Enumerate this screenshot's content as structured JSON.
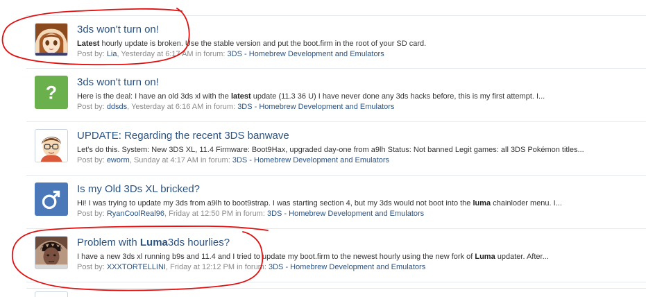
{
  "results": [
    {
      "title": "3ds won't turn on!",
      "snippet_bold": "Latest",
      "snippet_rest": " hourly update is broken. Use the stable version and put the boot.firm in the root of your SD card.",
      "post_by_label": "Post by:",
      "author": "Lia",
      "time": "Yesterday at 6:17 AM",
      "in_forum_label": "in forum:",
      "forum": "3DS - Homebrew Development and Emulators",
      "avatar": "anime-avatar"
    },
    {
      "title": "3ds won't turn on!",
      "snippet_pre": "Here is the deal: I have an old 3ds xl with the ",
      "snippet_bold": "latest",
      "snippet_post": " update (11.3 36 U) I have never done any 3ds hacks before, this is my first attempt. I...",
      "post_by_label": "Post by:",
      "author": "ddsds",
      "time": "Yesterday at 6:16 AM",
      "in_forum_label": "in forum:",
      "forum": "3DS - Homebrew Development and Emulators",
      "avatar": "question-mark-avatar"
    },
    {
      "title": "UPDATE: Regarding the recent 3DS banwave",
      "snippet": "Let's do this. System: New 3DS XL, 11.4 Firmware: Boot9Hax, upgraded day-one from a9lh Status: Not banned Legit games: all 3DS Pokémon titles...",
      "post_by_label": "Post by:",
      "author": "eworm",
      "time": "Sunday at 4:17 AM",
      "in_forum_label": "in forum:",
      "forum": "3DS - Homebrew Development and Emulators",
      "avatar": "cartoon-avatar"
    },
    {
      "title": "Is my Old 3Ds XL bricked?",
      "snippet_pre": "Hi! I was trying to update my 3ds from a9lh to boot9strap. I was starting section 4, but my 3ds would not boot into the ",
      "snippet_bold": "luma",
      "snippet_post": " chainloder menu. I...",
      "post_by_label": "Post by:",
      "author": "RyanCoolReal96",
      "time": "Friday at 12:50 PM",
      "in_forum_label": "in forum:",
      "forum": "3DS - Homebrew Development and Emulators",
      "avatar": "male-symbol-avatar"
    },
    {
      "title_pre": "Problem with ",
      "title_bold": "Luma",
      "title_post": "3ds hourlies?",
      "snippet_pre": "I have a new 3ds xl running b9s and 11.4 and I tried to update my boot.firm to the newest hourly using the new fork of ",
      "snippet_bold": "Luma",
      "snippet_post": " updater. After...",
      "post_by_label": "Post by:",
      "author": "XXXTORTELLINI",
      "time": "Friday at 12:12 PM",
      "in_forum_label": "in forum:",
      "forum": "3DS - Homebrew Development and Emulators",
      "avatar": "photo-avatar"
    }
  ],
  "colors": {
    "link": "#2b5381",
    "meta": "#8a8a8a",
    "annotation": "#e01010",
    "green_avatar": "#6ab04c",
    "blue_avatar": "#4a78b8"
  }
}
